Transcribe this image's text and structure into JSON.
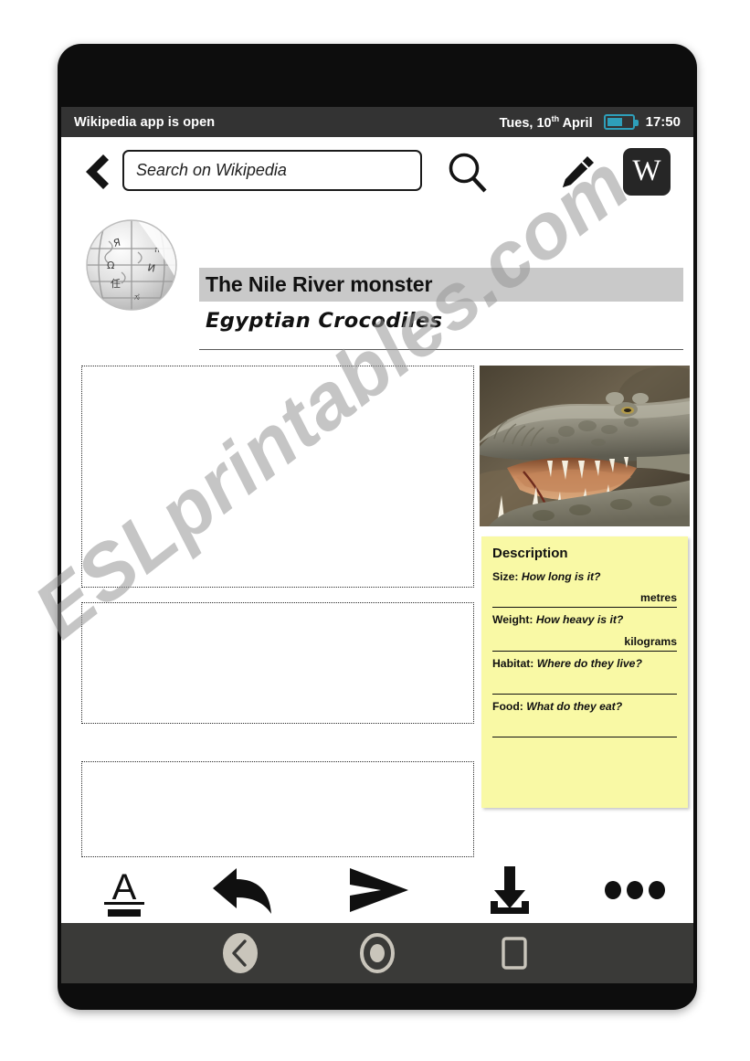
{
  "status_bar": {
    "app_status": "Wikipedia app is open",
    "date": "Tues, 10",
    "date_sup": "th",
    "date_month": " April",
    "time": "17:50",
    "battery_icon": "battery-icon",
    "battery_color": "#2e9fba"
  },
  "search_row": {
    "back_icon": "back-chevron-icon",
    "placeholder": "Search on Wikipedia",
    "search_icon": "magnifier-icon",
    "edit_icon": "pencil-icon",
    "wikipedia_logo_letter": "W"
  },
  "article": {
    "globe_icon": "wikipedia-globe-icon",
    "title": "The Nile River monster",
    "subtitle": "Egyptian Crocodiles",
    "title_highlight_color": "#c9c9c9",
    "photo_caption_alt": "crocodile-photo"
  },
  "answer_boxes": [
    {
      "name": "answer-box-1",
      "value": ""
    },
    {
      "name": "answer-box-2",
      "value": ""
    },
    {
      "name": "answer-box-3",
      "value": ""
    }
  ],
  "description": {
    "heading": "Description",
    "card_color": "#f9f9a5",
    "rows": [
      {
        "label": "Size:",
        "question": "How long is it?",
        "unit": "metres"
      },
      {
        "label": "Weight:",
        "question": "How heavy is it?",
        "unit": "kilograms"
      },
      {
        "label": "Habitat:",
        "question": "Where do they  live?",
        "unit": ""
      },
      {
        "label": "Food:",
        "question": "What do they eat?",
        "unit": ""
      }
    ]
  },
  "toolbar": [
    {
      "name": "text-format-button",
      "icon": "underlined-a-icon"
    },
    {
      "name": "reply-button",
      "icon": "reply-arrow-icon"
    },
    {
      "name": "send-button",
      "icon": "send-arrow-icon"
    },
    {
      "name": "download-button",
      "icon": "download-icon"
    },
    {
      "name": "more-button",
      "icon": "more-dots-icon"
    }
  ],
  "nav_bar": [
    {
      "name": "nav-back-button",
      "icon": "back-circle-icon"
    },
    {
      "name": "nav-home-button",
      "icon": "home-circle-icon"
    },
    {
      "name": "nav-recents-button",
      "icon": "square-icon"
    }
  ],
  "watermark": {
    "text": "ESLprintables.com"
  }
}
